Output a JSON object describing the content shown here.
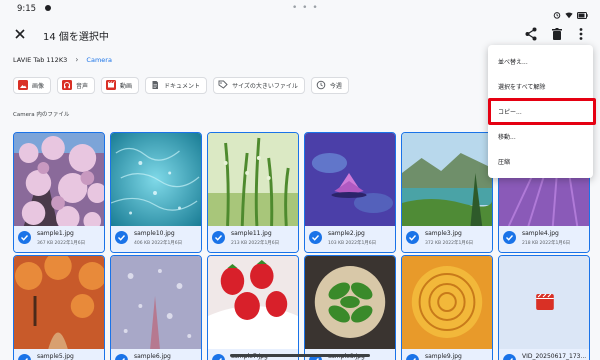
{
  "status": {
    "time": "9:15",
    "dots": "• • •"
  },
  "appbar": {
    "title": "14 個を選択中"
  },
  "breadcrumb": {
    "root": "LAVIE Tab 112K3",
    "current": "Camera"
  },
  "chips": [
    {
      "label": "画像",
      "color": "#d93025"
    },
    {
      "label": "音声",
      "color": "#d93025"
    },
    {
      "label": "動画",
      "color": "#d93025"
    },
    {
      "label": "ドキュメント",
      "color": "#5f6368"
    },
    {
      "label": "サイズの大きいファイル",
      "color": "#5f6368"
    },
    {
      "label": "今週",
      "color": "#5f6368"
    }
  ],
  "section_label": "Camera 内のファイル",
  "files": [
    {
      "name": "sample1.jpg",
      "info": "367 KB 2022年1月6日",
      "thumb": "blossom"
    },
    {
      "name": "sample10.jpg",
      "info": "406 KB 2022年1月6日",
      "thumb": "water"
    },
    {
      "name": "sample11.jpg",
      "info": "213 KB 2022年1月6日",
      "thumb": "grass"
    },
    {
      "name": "sample2.jpg",
      "info": "103 KB 2022年1月6日",
      "thumb": "lotus"
    },
    {
      "name": "sample3.jpg",
      "info": "372 KB 2022年1月6日",
      "thumb": "lake"
    },
    {
      "name": "sample4.jpg",
      "info": "218 KB 2022年1月6日",
      "thumb": "lavender"
    },
    {
      "name": "sample5.jpg",
      "info": "",
      "thumb": "autumn"
    },
    {
      "name": "sample6.jpg",
      "info": "",
      "thumb": "frost"
    },
    {
      "name": "sample7.jpg",
      "info": "",
      "thumb": "strawberry"
    },
    {
      "name": "sample8.jpg",
      "info": "",
      "thumb": "basil"
    },
    {
      "name": "sample9.jpg",
      "info": "",
      "thumb": "rose"
    },
    {
      "name": "VID_20250617_173...",
      "info": "",
      "thumb": "video"
    }
  ],
  "menu": {
    "items": [
      "並べ替え...",
      "選択をすべて解除",
      "コピー...",
      "移動...",
      "圧縮"
    ],
    "highlighted_index": 2
  },
  "colors": {
    "accent": "#1a73e8",
    "highlight": "#e50012"
  }
}
